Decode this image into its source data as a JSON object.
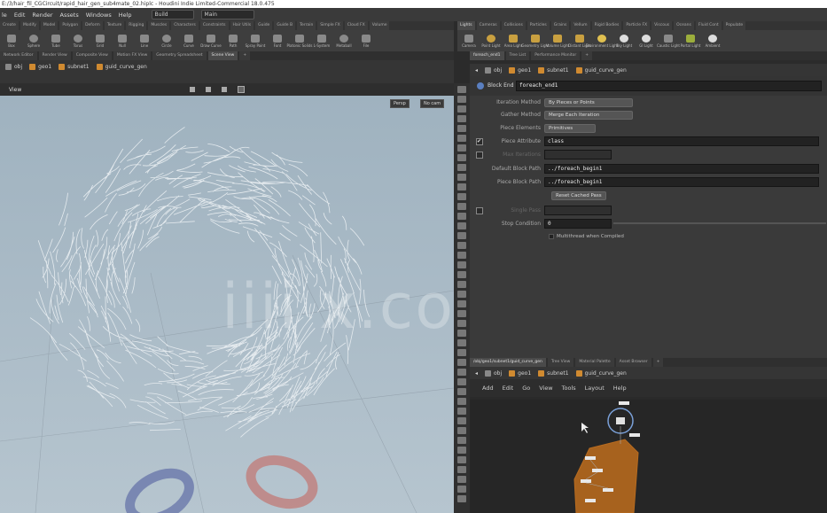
{
  "titlebar": {
    "text": "E:/3/hair_fil_CGCircuit/rapid_hair_gen_sub4mate_02.hiplc - Houdini Indie Limited-Commercial 18.0.475"
  },
  "menu": {
    "items": [
      "le",
      "Edit",
      "Render",
      "Assets",
      "Windows",
      "Help"
    ],
    "desktop": "Build",
    "second": "Main"
  },
  "shelf_tabs_left": [
    "Create",
    "Modify",
    "Model",
    "Polygon",
    "Deform",
    "Texture",
    "Rigging",
    "Muscles",
    "Characters",
    "Constraints",
    "Hair Utils",
    "Guide",
    "Guide B",
    "Terrain",
    "Simple FX",
    "Cloud FX",
    "Volume"
  ],
  "shelf_tabs_right": [
    "Lights",
    "Cameras",
    "Collisions",
    "Particles",
    "Grains",
    "Vellum",
    "Rigid Bodies",
    "Particle FX",
    "Viscous",
    "Oceans",
    "Fluid Cont",
    "Populate"
  ],
  "tools_left": [
    "Box",
    "Sphere",
    "Tube",
    "Torus",
    "Grid",
    "Null",
    "Line",
    "Circle",
    "Curve",
    "Draw Curve",
    "Path",
    "Spray Paint",
    "Font",
    "Platonic Solids",
    "L-System",
    "Metaball",
    "File"
  ],
  "tools_right": [
    "Camera",
    "Point Light",
    "Area Light",
    "Geometry Light",
    "Volume Light",
    "Distant Light",
    "Environment Light",
    "Sky Light",
    "GI Light",
    "Caustic Light",
    "Portal Light",
    "Ambient"
  ],
  "pane_tabs_left": [
    "Network Editor",
    "Render View",
    "Composite View",
    "Motion FX View",
    "Geometry Spreadsheet",
    "Scene View"
  ],
  "pane_tabs_right": [
    "foreach_end1",
    "Tree List",
    "Performance Monitor"
  ],
  "path_left": [
    "obj",
    "geo1",
    "subnet1",
    "guid_curve_gen"
  ],
  "path_right": [
    "obj",
    "geo1",
    "subnet1",
    "guid_curve_gen"
  ],
  "viewport": {
    "label": "View",
    "persp": "Persp",
    "cam": "No cam"
  },
  "node_header": {
    "type": "Block End",
    "name": "foreach_end1"
  },
  "params": {
    "iteration_method": {
      "label": "Iteration Method",
      "value": "By Pieces or Points"
    },
    "gather_method": {
      "label": "Gather Method",
      "value": "Merge Each Iteration"
    },
    "piece_elements": {
      "label": "Piece Elements",
      "value": "Primitives"
    },
    "piece_attribute": {
      "label": "Piece Attribute",
      "value": "class"
    },
    "use_max_iter": {
      "label": "Max Iterations"
    },
    "block_path": {
      "label": "Default Block Path",
      "value": "../foreach_begin1"
    },
    "piece_block_path": {
      "label": "Piece Block Path",
      "value": "../foreach_begin1"
    },
    "reset_cook": {
      "label": "Reset Cached Pass"
    },
    "stop_cond_toggle": {
      "label": "Single Pass"
    },
    "stop_condition": {
      "label": "Stop Condition",
      "value": "0"
    },
    "multithread": {
      "label": "Multithread when Compiled"
    }
  },
  "net_tabs": [
    "/obj/geo1/subnet1/guid_curve_gen",
    "Tree View",
    "Material Palette",
    "Asset Browser"
  ],
  "net_menu": [
    "Add",
    "Edit",
    "Go",
    "View",
    "Tools",
    "Layout",
    "Help"
  ],
  "watermark": "iiii x.com",
  "colors": {
    "node_net": "#c8731f",
    "accent": "#d08a30"
  }
}
